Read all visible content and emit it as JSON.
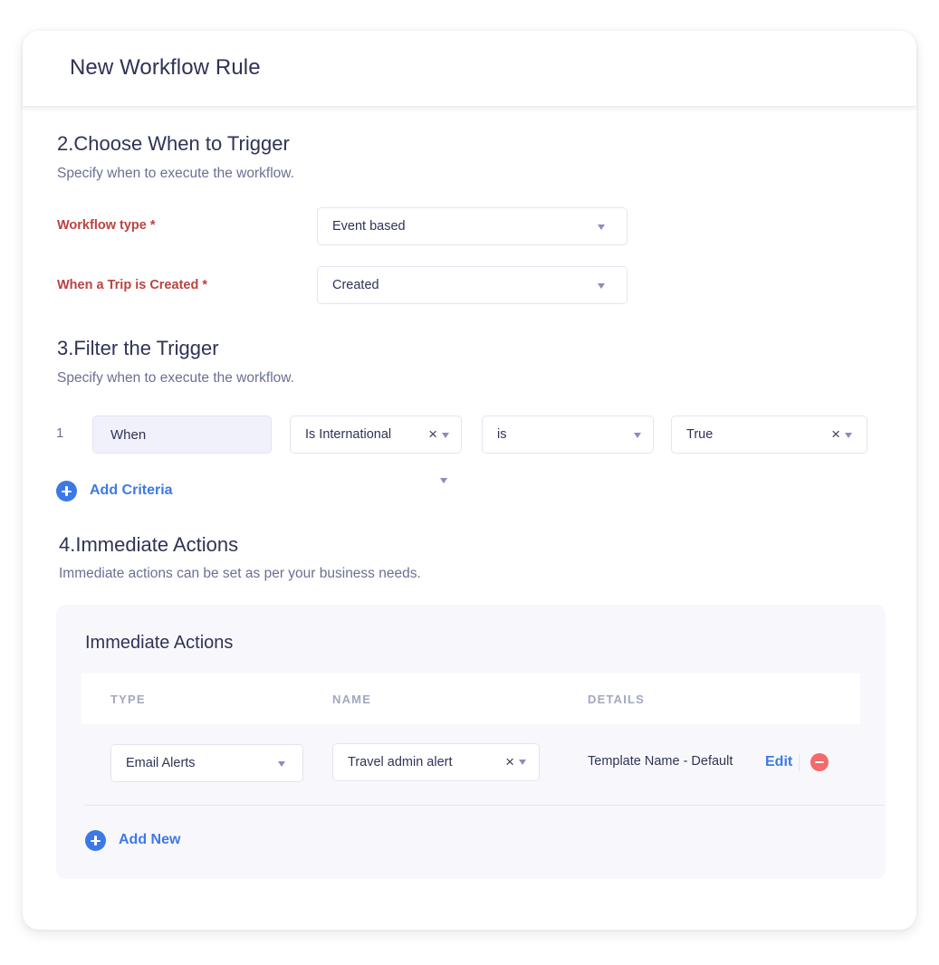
{
  "header": {
    "title": "New Workflow Rule"
  },
  "trigger_section": {
    "title": "2.Choose When to Trigger",
    "subtitle": "Specify when to execute the workflow.",
    "fields": [
      {
        "label": "Workflow type *",
        "value": "Event based"
      },
      {
        "label": "When a Trip is Created *",
        "value": "Created"
      }
    ]
  },
  "filter_section": {
    "title": "3.Filter the Trigger",
    "subtitle": "Specify when to execute the workflow.",
    "criteria": [
      {
        "index": "1",
        "when": "When",
        "field": "Is International",
        "operator": "is",
        "value": "True"
      }
    ],
    "add_label": "Add Criteria"
  },
  "actions_section": {
    "title": "4.Immediate Actions",
    "subtitle": "Immediate actions can be set as per your business needs.",
    "panel_title": "Immediate Actions",
    "columns": [
      "TYPE",
      "NAME",
      "DETAILS"
    ],
    "rows": [
      {
        "type": "Email Alerts",
        "name": "Travel admin alert",
        "details": "Template Name - Default",
        "edit_label": "Edit"
      }
    ],
    "add_label": "Add New"
  },
  "icons": {
    "caret": "caret-down-icon",
    "clear": "close-icon",
    "add": "plus-circle-icon",
    "remove": "minus-circle-icon"
  },
  "colors": {
    "accent": "#3c79e8",
    "required_label": "#b94343",
    "danger": "#f26a6a",
    "panel_bg": "#f8f8fc"
  }
}
